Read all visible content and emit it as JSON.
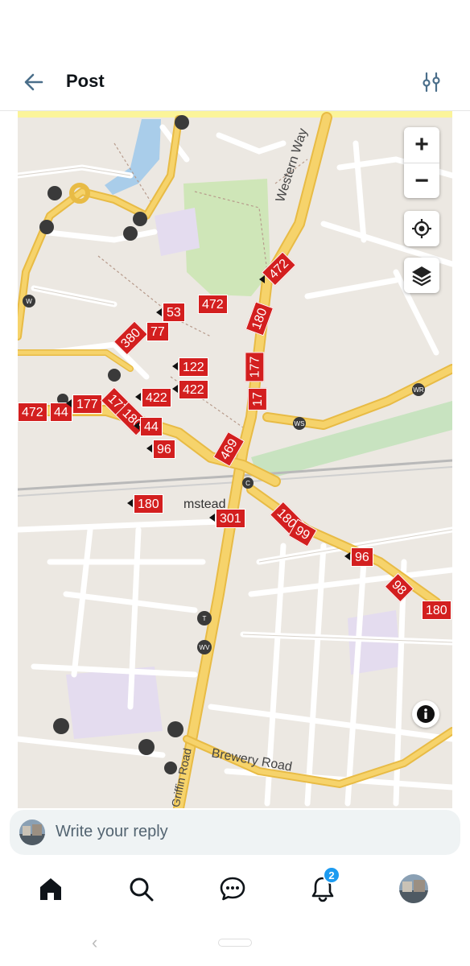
{
  "header": {
    "title": "Post",
    "back_icon": "arrow-left-icon",
    "filter_icon": "sliders-icon"
  },
  "map": {
    "controls": {
      "zoom_in": "+",
      "zoom_out": "−",
      "locate_icon": "crosshair-icon",
      "layers_icon": "layers-icon",
      "info_icon": "info-icon"
    },
    "place_labels": {
      "western_way": "Western Way",
      "brewery_road": "Brewery Road",
      "station": "mstead",
      "griffin_road": "Griffin Road"
    },
    "stop_codes": [
      "T",
      "WV",
      "WR",
      "WS",
      "W",
      "C"
    ],
    "bus_labels": [
      "472",
      "53",
      "472",
      "380",
      "77",
      "180",
      "122",
      "422",
      "422",
      "177",
      "177",
      "17",
      "472",
      "44",
      "177",
      "180",
      "44",
      "96",
      "469",
      "180",
      "301",
      "180",
      "99",
      "96",
      "98",
      "180"
    ],
    "colors": {
      "bus_label": "#d31f1f",
      "highlight_band": "#fbf49a",
      "road_major": "#f6d36b",
      "park": "#cfe6b8",
      "water": "#a9cdea",
      "railway": "#c8e3c0"
    }
  },
  "reply": {
    "placeholder": "Write your reply"
  },
  "tabs": {
    "home_icon": "home-icon",
    "search_icon": "search-icon",
    "messages_icon": "chat-bubble-icon",
    "notifications_icon": "bell-icon",
    "notifications_count": "2",
    "profile_icon": "avatar"
  }
}
